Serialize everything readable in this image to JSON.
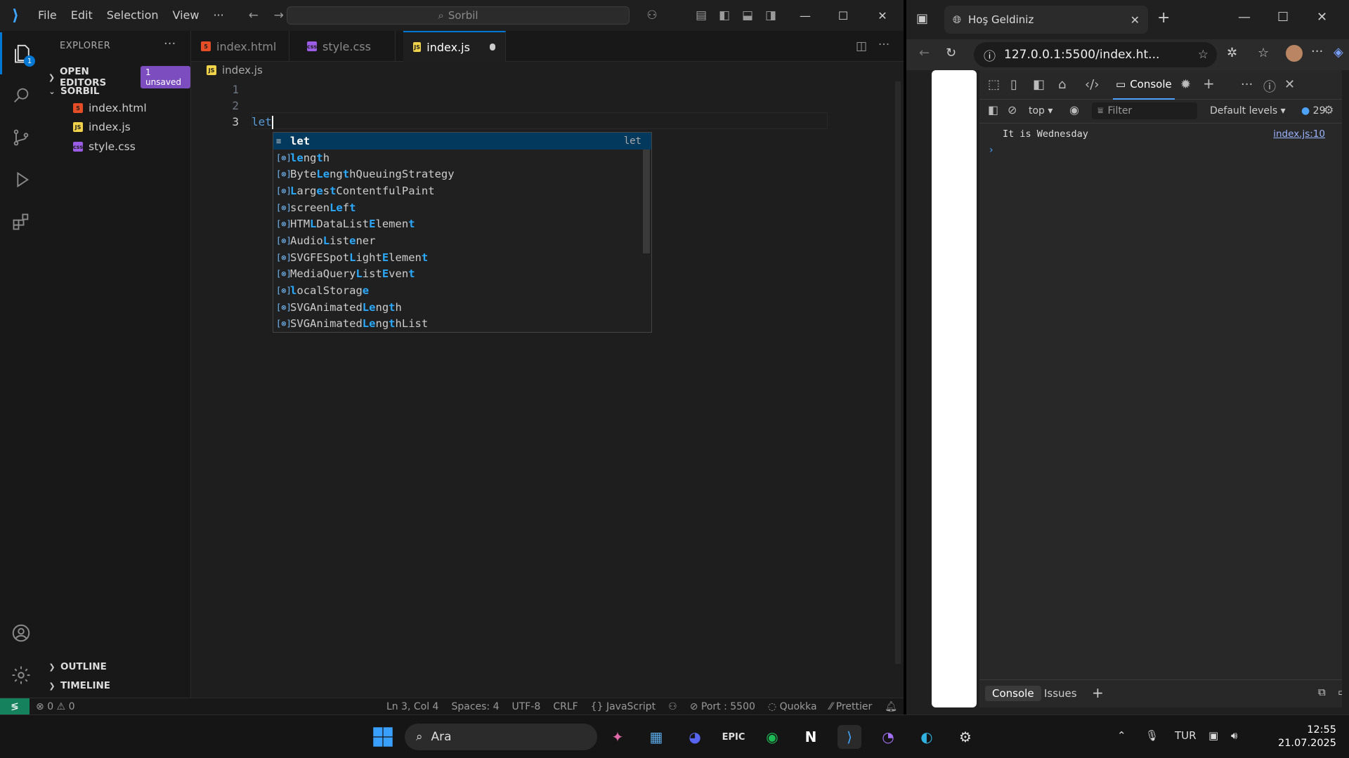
{
  "vscode": {
    "menu": [
      "File",
      "Edit",
      "Selection",
      "View",
      "···"
    ],
    "search_text": "Sorbil",
    "activity_badge": "1",
    "sidebar": {
      "title": "EXPLORER",
      "open_editors": "OPEN EDITORS",
      "unsaved_badge": "1 unsaved",
      "folder": "SORBIL",
      "files": [
        "index.html",
        "index.js",
        "style.css"
      ],
      "outline": "OUTLINE",
      "timeline": "TIMELINE"
    },
    "tabs": [
      "index.html",
      "style.css",
      "index.js"
    ],
    "breadcrumb": "index.js",
    "editor": {
      "line_numbers": [
        "1",
        "2",
        "3"
      ],
      "line3_text": "let"
    },
    "suggest": {
      "items": [
        {
          "label": "let",
          "detail": "let",
          "kind": "keyword"
        },
        {
          "label": "length",
          "kind": "variable"
        },
        {
          "label": "ByteLengthQueuingStrategy",
          "kind": "variable"
        },
        {
          "label": "LargestContentfulPaint",
          "kind": "variable"
        },
        {
          "label": "screenLeft",
          "kind": "variable"
        },
        {
          "label": "HTMLDataListElement",
          "kind": "variable"
        },
        {
          "label": "AudioListener",
          "kind": "variable"
        },
        {
          "label": "SVGFESpotLightElement",
          "kind": "variable"
        },
        {
          "label": "MediaQueryListEvent",
          "kind": "variable"
        },
        {
          "label": "localStorage",
          "kind": "variable"
        },
        {
          "label": "SVGAnimatedLength",
          "kind": "variable"
        },
        {
          "label": "SVGAnimatedLengthList",
          "kind": "variable"
        }
      ]
    },
    "status": {
      "errors": "0",
      "warnings": "0",
      "position": "Ln 3, Col 4",
      "spaces": "Spaces: 4",
      "encoding": "UTF-8",
      "eol": "CRLF",
      "language": "JavaScript",
      "port": "Port : 5500",
      "quokka": "Quokka",
      "prettier": "Prettier"
    }
  },
  "browser": {
    "tab_title": "Hoş Geldiniz",
    "url": "127.0.0.1:5500/index.ht...",
    "devtools": {
      "active_tab": "Console",
      "context": "top",
      "filter_placeholder": "Filter",
      "levels": "Default levels",
      "issues_count": "29",
      "log_message": "It is Wednesday",
      "log_source": "index.js:10",
      "drawer_tabs": [
        "Console",
        "Issues"
      ]
    }
  },
  "taskbar": {
    "search_text": "Ara",
    "language": "TUR",
    "time": "12:55",
    "date": "21.07.2025"
  },
  "colors": {
    "vscode_accent": "#0078d4",
    "remote_green": "#16825d",
    "unsaved_badge": "#7c4dbe",
    "suggest_match": "#2aaaff"
  }
}
